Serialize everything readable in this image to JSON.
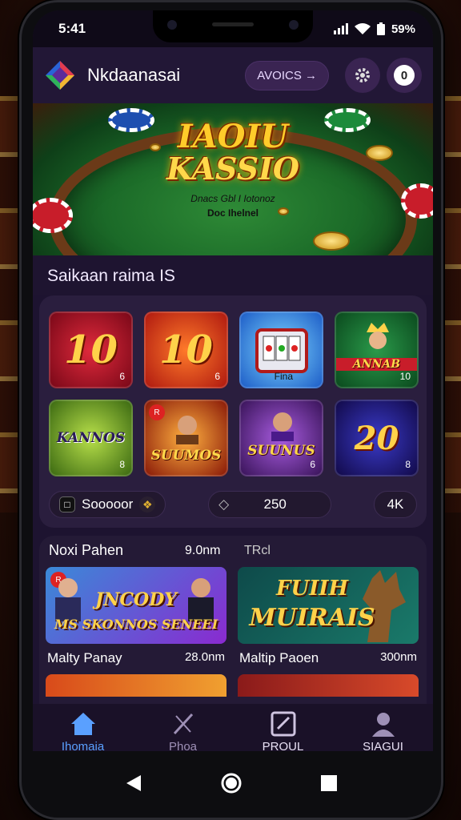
{
  "status_bar": {
    "time": "5:41",
    "battery": "59%"
  },
  "header": {
    "app_name": "Nkdaanasai",
    "promo_label": "AVOICS →",
    "settings_icon": "gear-icon",
    "profile_badge": "0"
  },
  "hero": {
    "title_line1": "IAOIU",
    "title_line2": "KASSIO",
    "subtitle": "Dnacs Gbl I Iotonoz",
    "subtitle2": "Doc Ihelnel"
  },
  "section": {
    "title": "Saikaan raima IS"
  },
  "games": [
    {
      "label": "10",
      "badge": "6"
    },
    {
      "label": "10",
      "badge": "6"
    },
    {
      "label": "",
      "badge": "Fina"
    },
    {
      "label": "ANNAB",
      "badge": "10"
    },
    {
      "label": "KANNOS",
      "badge": "8"
    },
    {
      "label": "SUUMOS",
      "badge": ""
    },
    {
      "label": "SUUNUS",
      "badge": "6"
    },
    {
      "label": "20",
      "badge": "8"
    }
  ],
  "grid_footer": {
    "left_label": "Sooooor",
    "middle_value": "250",
    "right_value": "4K"
  },
  "featured": {
    "heading": "Noxi Pahen",
    "heading_value": "9.0nm",
    "heading_tag": "TRcl",
    "cards": [
      {
        "title_top": "JNCODY",
        "title_bottom": "MS SKONNOS SENEEI",
        "name": "Malty Panay",
        "price": "28.0nm"
      },
      {
        "title_top": "FUIIH",
        "title_bottom": "MUIRAIS",
        "name": "Maltip Paoen",
        "price": "300nm"
      }
    ]
  },
  "bottom_nav": [
    {
      "label": "Ihomaia",
      "icon": "home-icon",
      "active": true
    },
    {
      "label": "Phoa",
      "icon": "swords-icon",
      "active": false
    },
    {
      "label": "PROUL",
      "icon": "edit-icon",
      "active": false
    },
    {
      "label": "SIAGUI",
      "icon": "user-icon",
      "active": false
    }
  ],
  "colors": {
    "accent": "#5aa0ff",
    "gold": "#ffd24a",
    "background": "#1d1330"
  }
}
